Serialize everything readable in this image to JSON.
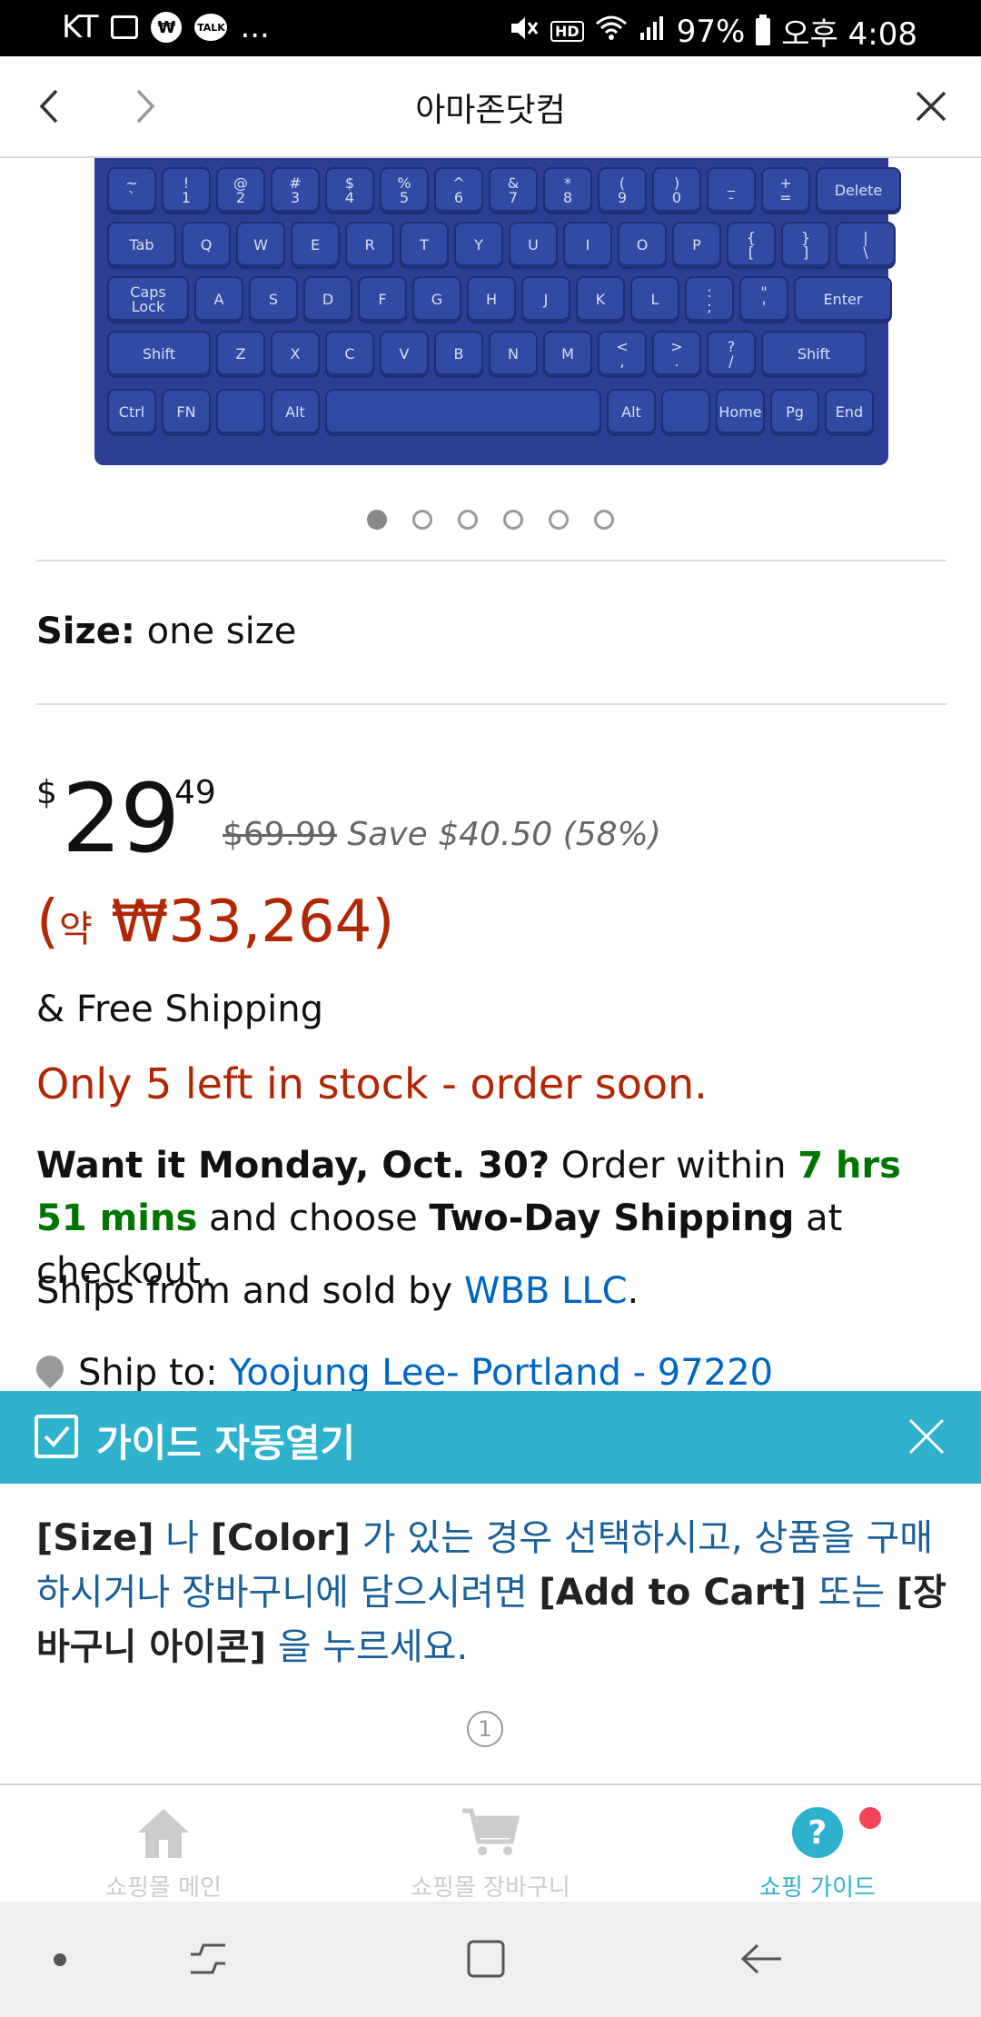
{
  "status_bar": {
    "carrier": "KT",
    "more": "...",
    "battery": "97%",
    "time": "오후 4:08"
  },
  "browser": {
    "title": "아마존닷컴"
  },
  "carousel": {
    "total_pages": 6,
    "active_index": 0
  },
  "product": {
    "size_label": "Size:",
    "size_value": "one size",
    "price_symbol": "$",
    "price_whole": "29",
    "price_fraction": "49",
    "list_price": "$69.99",
    "savings": "Save $40.50 (58%)",
    "krw_open": "(",
    "krw_prefix": "약",
    "krw_value": "₩33,264)",
    "shipping": "& Free Shipping",
    "stock": "Only 5 left in stock - order soon.",
    "delivery": {
      "want_it": "Want it Monday, Oct. 30?",
      "order_within": "Order within",
      "time_left": "7 hrs 51 mins",
      "and_choose": "and choose",
      "method": "Two-Day Shipping",
      "at_checkout": "at checkout."
    },
    "seller": {
      "prefix": "Ships from and sold by",
      "name": "WBB LLC",
      "suffix": "."
    },
    "ship_to": {
      "label": "Ship to:",
      "address": "Yoojung Lee- Portland - 97220"
    }
  },
  "guide": {
    "title": "가이드 자동열기",
    "text_parts": {
      "size": "[Size]",
      "t1": " 나 ",
      "color": "[Color]",
      "t2": " 가 있는 경우 선택하시고, 상품을 구매하시거나 장바구니에 담으시려면 ",
      "add_to_cart": "[Add to Cart]",
      "t3": " 또는 ",
      "cart_icon": "[장바구니 아이콘]",
      "t4": " 을 누르세요."
    },
    "page": "1"
  },
  "tabbar": {
    "tabs": [
      {
        "label": "쇼핑몰 메인",
        "icon": "home-icon"
      },
      {
        "label": "쇼핑몰 장바구니",
        "icon": "cart-icon"
      },
      {
        "label": "쇼핑 가이드",
        "icon": "help-icon"
      }
    ],
    "active": 2
  },
  "colors": {
    "accent": "#2eb1cd",
    "price_red": "#b12704",
    "link_blue": "#0066c0",
    "green": "#007600",
    "keyboard_blue": "#2c3d93"
  },
  "keyboard_keys": {
    "row1": [
      "~\n`",
      "!\n1",
      "@\n2",
      "#\n3",
      "$\n4",
      "%\n5",
      "^\n6",
      "&\n7",
      "*\n8",
      "(\n9",
      ")\n0",
      "_\n-",
      "+\n=",
      "Delete"
    ],
    "row2": [
      "Tab",
      "Q",
      "W",
      "E",
      "R",
      "T",
      "Y",
      "U",
      "I",
      "O",
      "P",
      "{\n[",
      "}\n]",
      "|\n\\"
    ],
    "row3": [
      "Caps\nLock",
      "A",
      "S",
      "D",
      "F",
      "G",
      "H",
      "J",
      "K",
      "L",
      ":\n;",
      "\"\n'",
      "Enter"
    ],
    "row4": [
      "Shift",
      "Z",
      "X",
      "C",
      "V",
      "B",
      "N",
      "M",
      "<\n,",
      ">\n.",
      "?\n/",
      "Shift"
    ],
    "row5": [
      "Ctrl",
      "FN",
      "",
      "Alt",
      "",
      "Alt",
      "",
      "Home",
      "Pg",
      "End"
    ]
  }
}
